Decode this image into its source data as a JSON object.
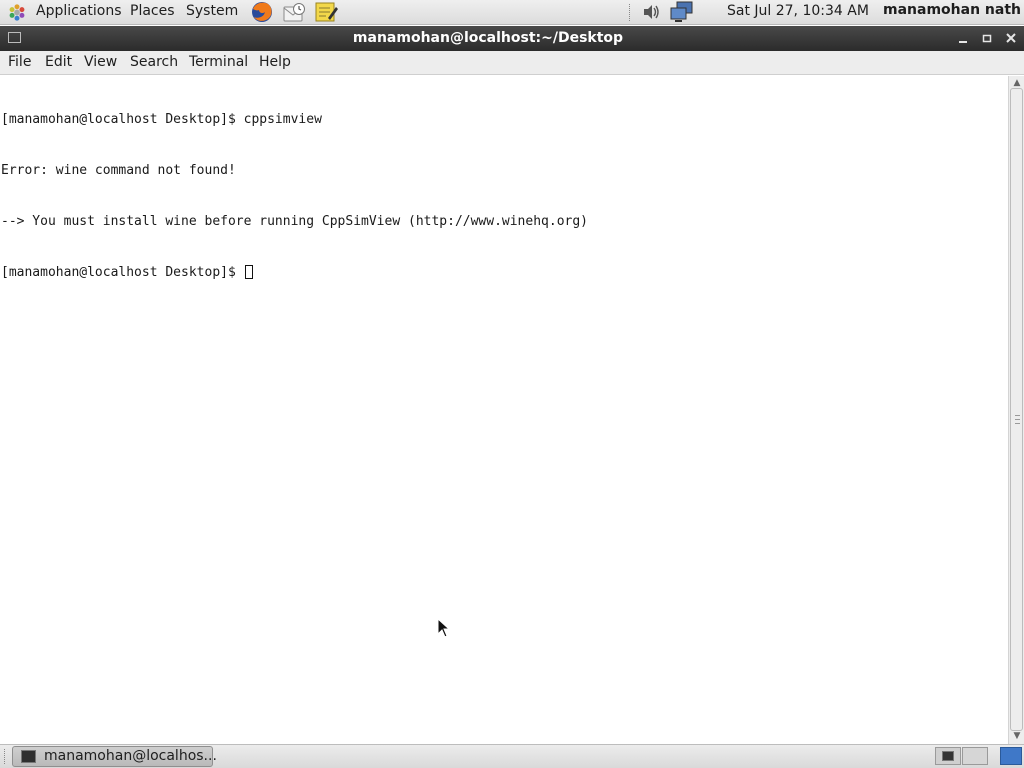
{
  "top_panel": {
    "menus": [
      "Applications",
      "Places",
      "System"
    ],
    "launchers": [
      "firefox-icon",
      "mail-client-icon",
      "text-editor-icon"
    ],
    "tray": [
      "volume-icon",
      "network-icon"
    ],
    "clock": "Sat Jul 27, 10:34 AM",
    "user": "manamohan nath"
  },
  "window": {
    "title": "manamohan@localhost:~/Desktop",
    "controls": [
      "minimize-icon",
      "maximize-icon",
      "close-icon"
    ]
  },
  "menubar": {
    "items": [
      "File",
      "Edit",
      "View",
      "Search",
      "Terminal",
      "Help"
    ]
  },
  "terminal": {
    "lines": [
      "[manamohan@localhost Desktop]$ cppsimview",
      "Error: wine command not found!",
      "--> You must install wine before running CppSimView (http://www.winehq.org)",
      "[manamohan@localhost Desktop]$ "
    ]
  },
  "taskbar": {
    "task_label": "manamohan@localhos..."
  },
  "colors": {
    "titlebar": "#2b2b2b",
    "panel": "#e4e4e4",
    "terminal_bg": "#ffffff",
    "terminal_fg": "#1a1a1a"
  }
}
